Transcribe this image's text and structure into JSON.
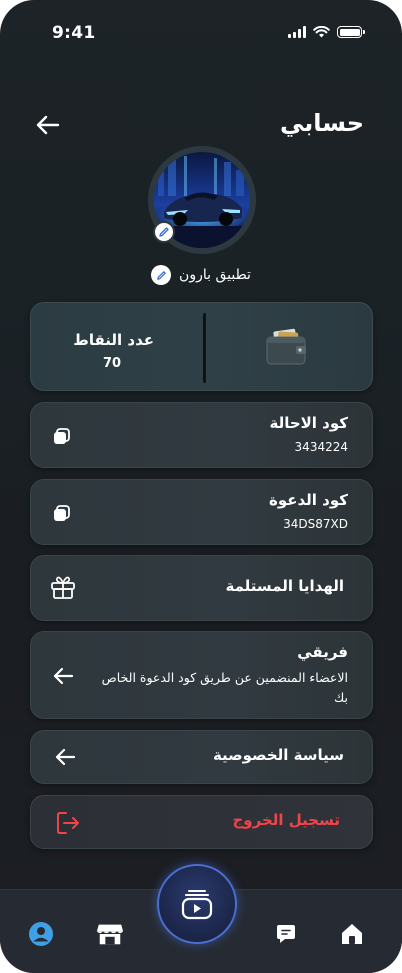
{
  "status_bar": {
    "time": "9:41"
  },
  "header": {
    "title": "حسابي"
  },
  "profile": {
    "name": "تطبيق بارون"
  },
  "points": {
    "label": "عدد النقاط",
    "value": "70"
  },
  "referral": {
    "title": "كود الاحالة",
    "code": "3434224"
  },
  "invite": {
    "title": "كود الدعوة",
    "code": "34DS87XD"
  },
  "gifts": {
    "title": "الهدايا المستلمة"
  },
  "team": {
    "title": "فريقي",
    "subtitle": "الاعضاء المنضمين عن طريق كود الدعوة الخاص بك"
  },
  "privacy": {
    "title": "سياسة الخصوصية"
  },
  "logout": {
    "title": "تسجيل الخروج"
  },
  "colors": {
    "logout_red": "#f0444b",
    "accent_blue": "#3fa0e6",
    "fab_border": "#4b6fd0"
  },
  "bottom_nav": {
    "items": [
      "profile-icon",
      "store-icon",
      "videos-icon",
      "chat-icon",
      "home-icon"
    ],
    "active": "profile-icon"
  }
}
